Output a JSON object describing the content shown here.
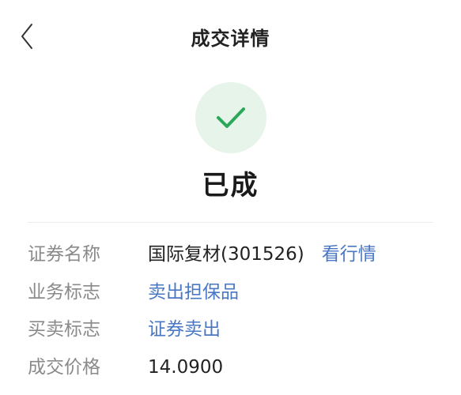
{
  "header": {
    "title": "成交详情",
    "back_icon": "chevron-left-icon"
  },
  "status": {
    "icon": "check-icon",
    "text": "已成",
    "accent_color": "#2aa85a",
    "circle_color": "#e6f4ea"
  },
  "details": [
    {
      "label": "证券名称",
      "value": "国际复材(301526)",
      "action": "看行情"
    },
    {
      "label": "业务标志",
      "value": "卖出担保品"
    },
    {
      "label": "买卖标志",
      "value": "证券卖出"
    },
    {
      "label": "成交价格",
      "value": "14.0900"
    }
  ],
  "colors": {
    "link": "#4a77c4",
    "label": "#8a8a8a",
    "text": "#222222"
  }
}
